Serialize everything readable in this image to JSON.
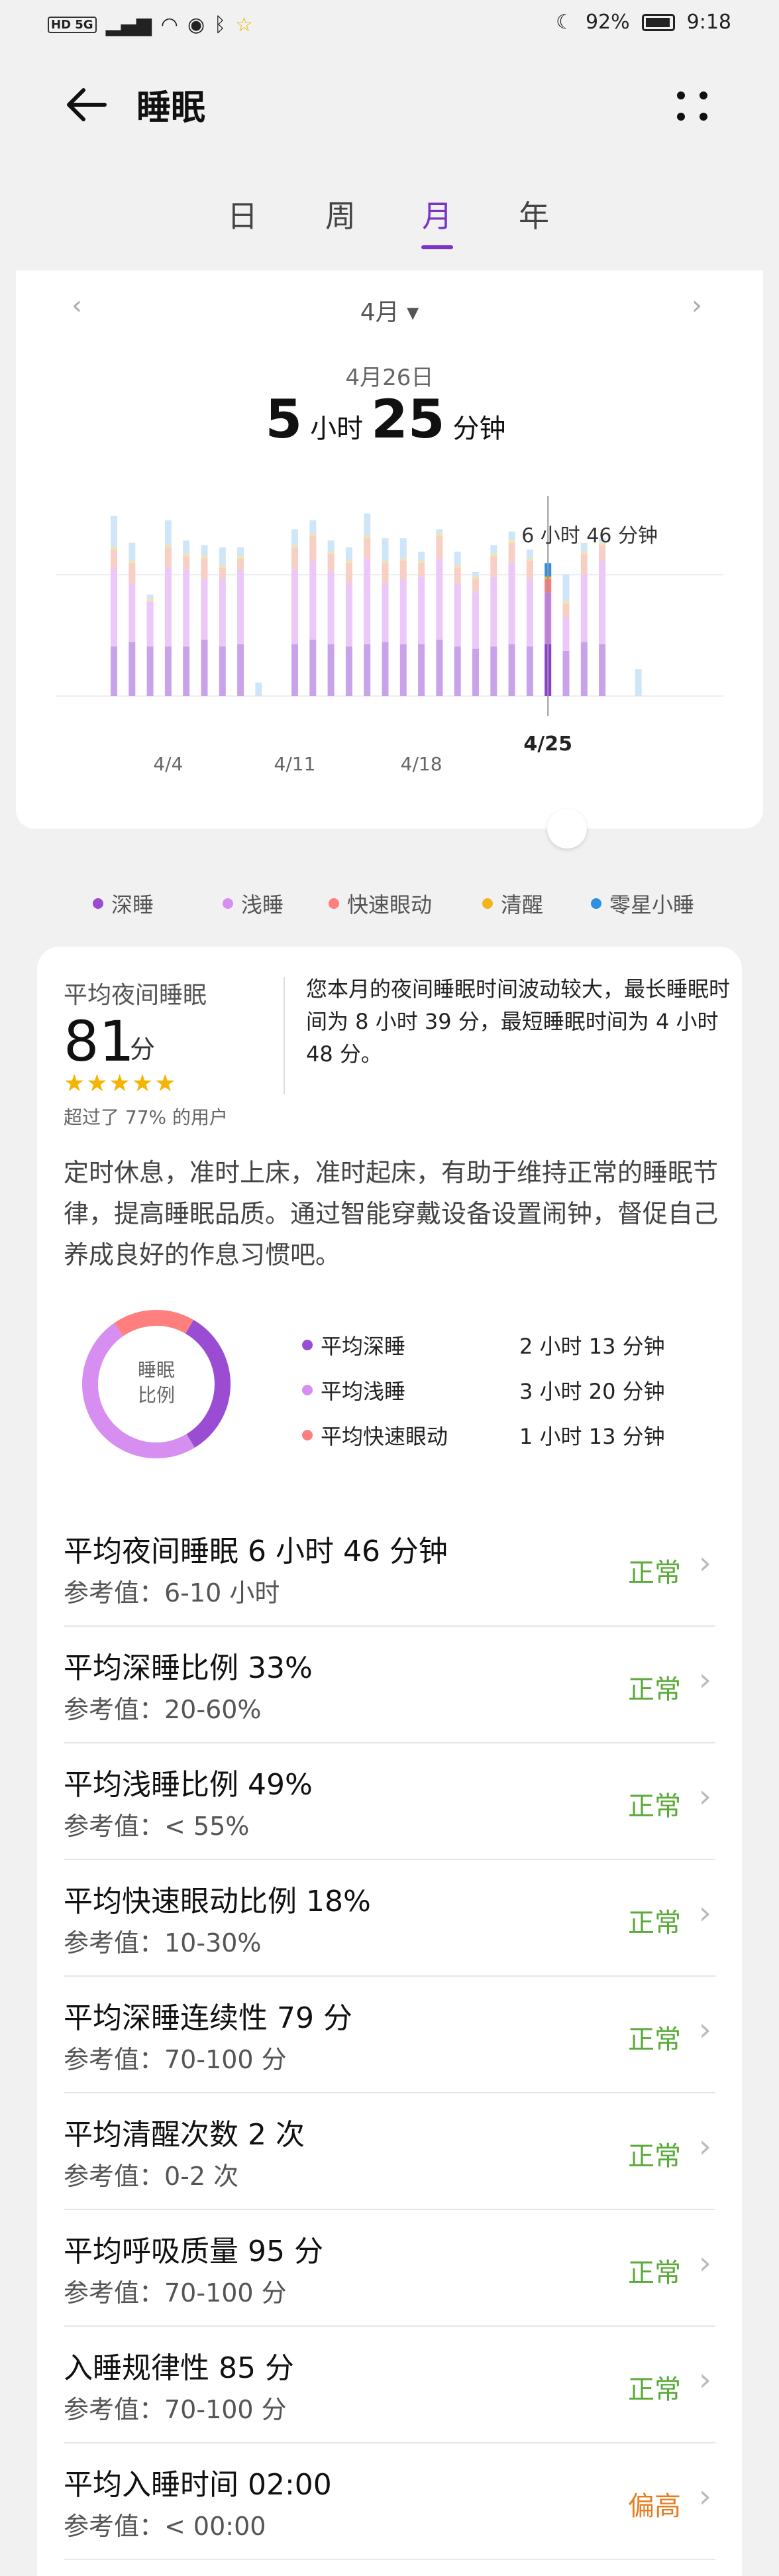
{
  "status_bar": {
    "left_icons": "HD 5G",
    "battery": "92%",
    "time": "9:18"
  },
  "app": {
    "title": "睡眠"
  },
  "tabs": [
    {
      "label": "日"
    },
    {
      "label": "周"
    },
    {
      "label": "月",
      "active": true
    },
    {
      "label": "年"
    }
  ],
  "month_nav": {
    "label": "4月 ▾",
    "prev": "‹",
    "next": "›"
  },
  "selected": {
    "date": "4月26日",
    "hours": "5",
    "hours_unit": "小时",
    "minutes": "25",
    "minutes_unit": "分钟"
  },
  "colors": {
    "deep": "#9a4cd3",
    "light": "#d68ff0",
    "rem": "#ff7f7f",
    "awake": "#f3b51a",
    "nap": "#2f8fe3",
    "accent": "#7a35c8",
    "normal": "#5aaa3a",
    "high": "#e67e22"
  },
  "chart_data": {
    "type": "bar",
    "stacked": true,
    "x": [
      "4/1",
      "4/2",
      "4/3",
      "4/4",
      "4/5",
      "4/6",
      "4/7",
      "4/8",
      "4/9",
      "4/10",
      "4/11",
      "4/12",
      "4/13",
      "4/14",
      "4/15",
      "4/16",
      "4/17",
      "4/18",
      "4/19",
      "4/20",
      "4/21",
      "4/22",
      "4/23",
      "4/24",
      "4/25",
      "4/26",
      "4/27",
      "4/28",
      "4/29",
      "4/30"
    ],
    "xticks": [
      "4/4",
      "4/11",
      "4/18"
    ],
    "highlight": "4/25",
    "avg_line_label": "6 小时 46 分钟",
    "series": [
      {
        "name": "深睡",
        "values": [
          2.2,
          2.4,
          2.2,
          2.2,
          2.2,
          2.5,
          2.2,
          2.3,
          0,
          0,
          2.3,
          2.5,
          2.3,
          2.2,
          2.3,
          2.4,
          2.3,
          2.3,
          2.5,
          2.2,
          2.1,
          2.2,
          2.3,
          2.2,
          2.3,
          2.0,
          2.4,
          2.3,
          0,
          0
        ]
      },
      {
        "name": "浅睡",
        "values": [
          3.5,
          2.6,
          2.0,
          3.5,
          3.4,
          2.7,
          3.0,
          3.3,
          0,
          0,
          3.3,
          3.5,
          3.2,
          2.8,
          3.8,
          2.6,
          2.9,
          3.0,
          3.6,
          2.8,
          2.5,
          3.1,
          3.6,
          3.0,
          2.3,
          1.5,
          3.0,
          3.7,
          0,
          0
        ]
      },
      {
        "name": "快速眼动",
        "values": [
          0.8,
          0.9,
          0,
          0.9,
          0.6,
          0.9,
          0.5,
          0.5,
          0,
          0,
          1.0,
          1.1,
          0.8,
          0.9,
          0.9,
          0.9,
          0.8,
          0.6,
          1.0,
          0.7,
          0.6,
          0.9,
          0.9,
          0.8,
          0.6,
          0.6,
          0.9,
          0.7,
          0,
          0
        ]
      },
      {
        "name": "清醒",
        "values": [
          0.1,
          0.1,
          0.1,
          0.1,
          0.1,
          0.1,
          0.1,
          0.1,
          0,
          0,
          0.1,
          0.1,
          0.1,
          0.1,
          0.1,
          0.1,
          0.1,
          0.1,
          0.1,
          0.1,
          0.1,
          0.1,
          0.1,
          0.1,
          0.1,
          0.1,
          0.1,
          0.1,
          0,
          0
        ]
      },
      {
        "name": "零星小睡",
        "values": [
          1.4,
          0.8,
          0.2,
          1.1,
          0.6,
          0.5,
          0.8,
          0.4,
          0.6,
          0,
          0.7,
          0.6,
          0.5,
          0.6,
          1.0,
          1.0,
          0.9,
          0.4,
          0.2,
          0.6,
          0.2,
          0.4,
          0.4,
          0.4,
          0.6,
          1.2,
          0.4,
          0.2,
          0,
          1.2
        ]
      }
    ]
  },
  "legend": [
    {
      "label": "深睡",
      "color": "#9a4cd3"
    },
    {
      "label": "浅睡",
      "color": "#d68ff0"
    },
    {
      "label": "快速眼动",
      "color": "#ff7f7f"
    },
    {
      "label": "清醒",
      "color": "#f3b51a"
    },
    {
      "label": "零星小睡",
      "color": "#2f8fe3"
    }
  ],
  "summary": {
    "label": "平均夜间睡眠",
    "score": "81",
    "score_unit": "分",
    "stars": "★★★★★",
    "beat": "超过了 77% 的用户",
    "message": "您本月的夜间睡眠时间波动较大，最长睡眠时间为 8 小时 39 分，最短睡眠时间为 4 小时 48 分。",
    "advice": "定时休息，准时上床，准时起床，有助于维持正常的睡眠节律，提高睡眠品质。通过智能穿戴设备设置闹钟，督促自己养成良好的作息习惯吧。"
  },
  "ratio": {
    "center": "睡眠\n比例",
    "items": [
      {
        "label": "平均深睡",
        "value": "2 小时 13 分钟",
        "color": "#9a4cd3",
        "pct": 33
      },
      {
        "label": "平均浅睡",
        "value": "3 小时 20 分钟",
        "color": "#d68ff0",
        "pct": 49
      },
      {
        "label": "平均快速眼动",
        "value": "1 小时 13 分钟",
        "color": "#ff7f7f",
        "pct": 18
      }
    ]
  },
  "metrics": [
    {
      "title": "平均夜间睡眠  6 小时 46 分钟",
      "ref": "参考值：6-10 小时",
      "status": "正常",
      "level": "normal"
    },
    {
      "title": "平均深睡比例  33%",
      "ref": "参考值：20-60%",
      "status": "正常",
      "level": "normal"
    },
    {
      "title": "平均浅睡比例  49%",
      "ref": "参考值：< 55%",
      "status": "正常",
      "level": "normal"
    },
    {
      "title": "平均快速眼动比例  18%",
      "ref": "参考值：10-30%",
      "status": "正常",
      "level": "normal"
    },
    {
      "title": "平均深睡连续性  79 分",
      "ref": "参考值：70-100 分",
      "status": "正常",
      "level": "normal"
    },
    {
      "title": "平均清醒次数  2 次",
      "ref": "参考值：0-2 次",
      "status": "正常",
      "level": "normal"
    },
    {
      "title": "平均呼吸质量  95 分",
      "ref": "参考值：70-100 分",
      "status": "正常",
      "level": "normal"
    },
    {
      "title": "入睡规律性  85 分",
      "ref": "参考值：70-100 分",
      "status": "正常",
      "level": "normal"
    },
    {
      "title": "平均入睡时间  02:00",
      "ref": "参考值：< 00:00",
      "status": "偏高",
      "level": "high"
    }
  ]
}
